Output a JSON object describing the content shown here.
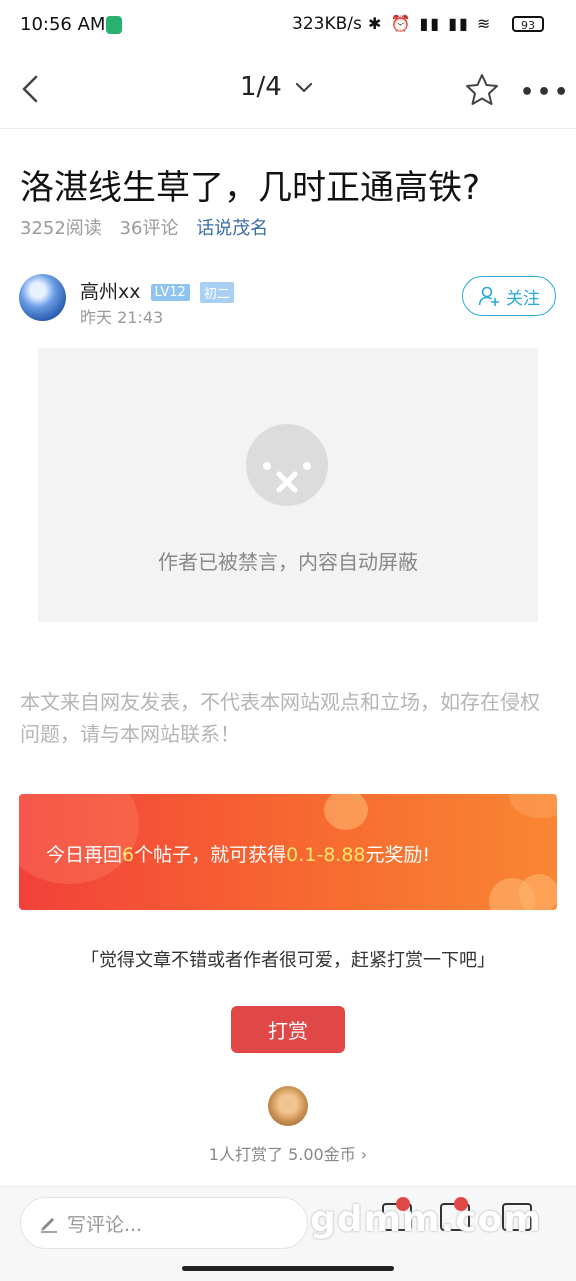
{
  "status": {
    "time": "10:56 AM",
    "speed": "323KB/s",
    "icons": "✱ ⏰ ▮▮ ▮▮ ≋",
    "battery": "93"
  },
  "nav": {
    "pager": "1/4",
    "chevron": "⌄"
  },
  "article": {
    "title": "洛湛线生草了，几时正通高铁?",
    "reads": "3252阅读",
    "comments": "36评论",
    "topic": "话说茂名",
    "author": "高州xx",
    "level": "LV12",
    "grade": "初二",
    "date": "昨天 21:43",
    "follow": "关注"
  },
  "blocked_text": "作者已被禁言，内容自动屏蔽",
  "disclaimer": "本文来自网友发表，不代表本网站观点和立场，如存在侵权问题，请与本网站联系！",
  "banner": {
    "prefix": "今日再回",
    "num": "6",
    "mid": "个帖子，就可获得",
    "range": "0.1-8.88",
    "suffix": "元奖励!"
  },
  "quote": "「觉得文章不错或者作者很可爱，赶紧打赏一下吧」",
  "reward_button": "打赏",
  "reward_count": "1人打赏了 5.00金币 ›",
  "bottom": {
    "comment_placeholder": "写评论...",
    "watermark": "gdmm.com"
  },
  "colors": {
    "accent": "#2aa9d6",
    "reward": "#e04848",
    "topic": "#3c6ea8"
  }
}
